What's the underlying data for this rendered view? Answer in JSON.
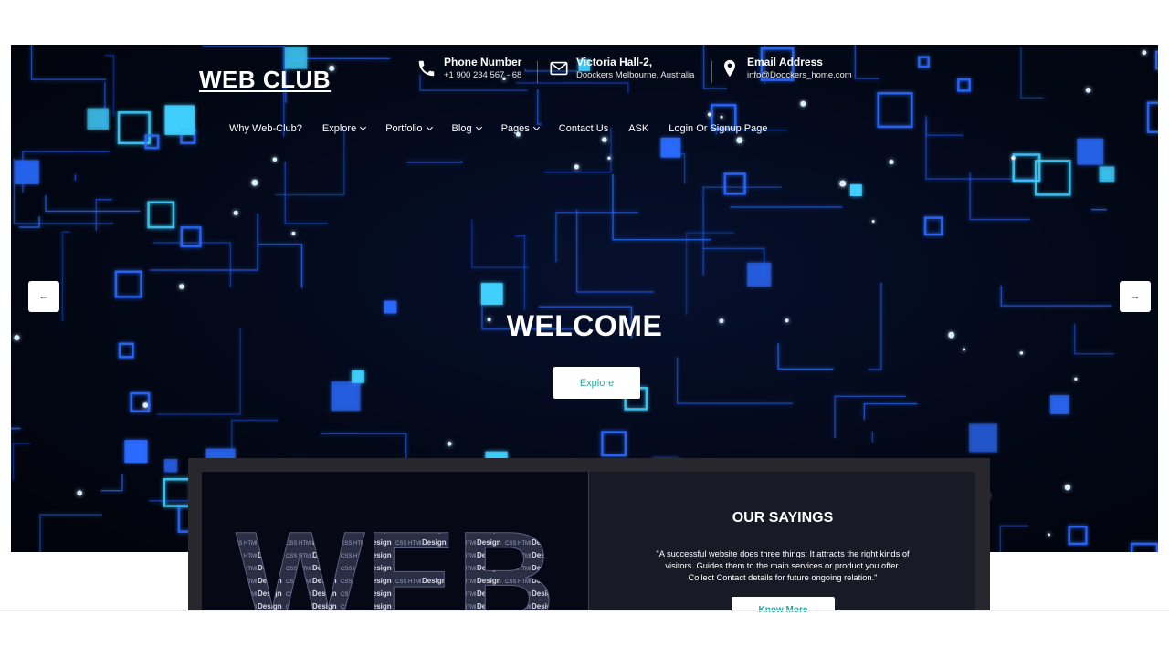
{
  "brand": {
    "logo_text": "WEB CLUB"
  },
  "contacts": [
    {
      "icon": "phone-icon",
      "title": "Phone Number",
      "detail": "+1 900 234 567 - 68"
    },
    {
      "icon": "envelope-icon",
      "title": "Victoria Hall-2,",
      "detail": "Doockers Melbourne, Australia"
    },
    {
      "icon": "location-pin-icon",
      "title": "Email Address",
      "detail": "info@Doockers_home.com"
    }
  ],
  "nav": [
    {
      "label": "Why Web-Club?",
      "dropdown": false
    },
    {
      "label": "Explore",
      "dropdown": true
    },
    {
      "label": "Portfolio",
      "dropdown": true
    },
    {
      "label": "Blog",
      "dropdown": true
    },
    {
      "label": "Pages",
      "dropdown": true
    },
    {
      "label": "Contact Us",
      "dropdown": false
    },
    {
      "label": "ASK",
      "dropdown": false
    },
    {
      "label": "Login Or Signup Page",
      "dropdown": false
    }
  ],
  "hero": {
    "heading": "WELCOME",
    "button_label": "Explore",
    "prev_arrow": "←",
    "next_arrow": "→"
  },
  "sayings": {
    "title": "OUR SAYINGS",
    "quote": "\"A successful website does three things: It attracts the right kinds of visitors. Guides them to the main services or product you offer. Collect Contact details for future ongoing relation.\"",
    "button_label": "Know More",
    "image_word": "WEB"
  },
  "colors": {
    "accent_teal": "#2aa6a0",
    "hero_glow": "#1e90ff",
    "card_bg": "#27272d"
  }
}
